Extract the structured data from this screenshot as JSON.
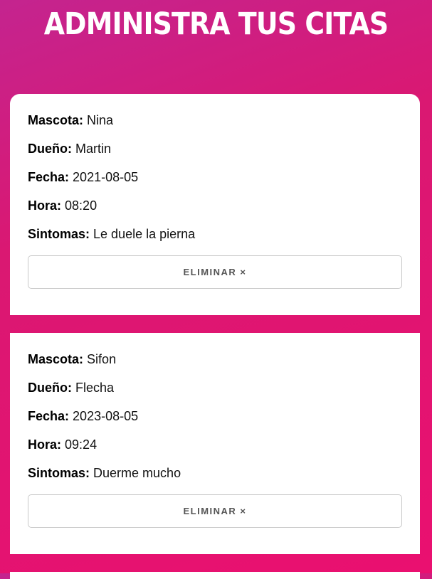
{
  "header": {
    "title": "ADMINISTRA TUS CITAS"
  },
  "labels": {
    "mascota": "Mascota:",
    "dueno": "Dueño:",
    "fecha": "Fecha:",
    "hora": "Hora:",
    "sintomas": "Sintomas:"
  },
  "appointments": [
    {
      "mascota": "Nina",
      "dueno": "Martin",
      "fecha": "2021-08-05",
      "hora": "08:20",
      "sintomas": "Le duele la pierna",
      "delete_label": "ELIMINAR ×"
    },
    {
      "mascota": "Sifon",
      "dueno": "Flecha",
      "fecha": "2023-08-05",
      "hora": "09:24",
      "sintomas": "Duerme mucho",
      "delete_label": "ELIMINAR ×"
    }
  ]
}
